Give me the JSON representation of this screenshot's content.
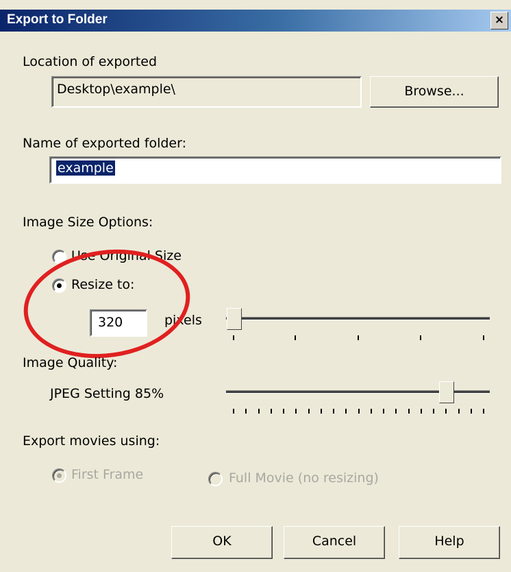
{
  "window": {
    "title": "Export to Folder",
    "close_label": "×"
  },
  "location": {
    "label": "Location of exported",
    "value": "Desktop\\example\\",
    "browse_label": "Browse..."
  },
  "folder_name": {
    "label": "Name of exported folder:",
    "value": "example"
  },
  "image_size": {
    "label": "Image Size Options:",
    "original_label": "Use Original Size",
    "resize_label": "Resize to:",
    "resize_value": "320",
    "units_label": "pixels",
    "slider_position": 0.0
  },
  "image_quality": {
    "label": "Image Quality:",
    "jpeg_label": "JPEG Setting 85%",
    "slider_value": 85
  },
  "export_movies": {
    "label": "Export movies using:",
    "first_frame_label": "First Frame",
    "full_movie_label": "Full Movie (no resizing)"
  },
  "buttons": {
    "ok": "OK",
    "cancel": "Cancel",
    "help": "Help"
  },
  "colors": {
    "title_start": "#0a246a",
    "title_end": "#a6caf0",
    "dialog_bg": "#ece9d8",
    "annotation": "#e02020"
  }
}
